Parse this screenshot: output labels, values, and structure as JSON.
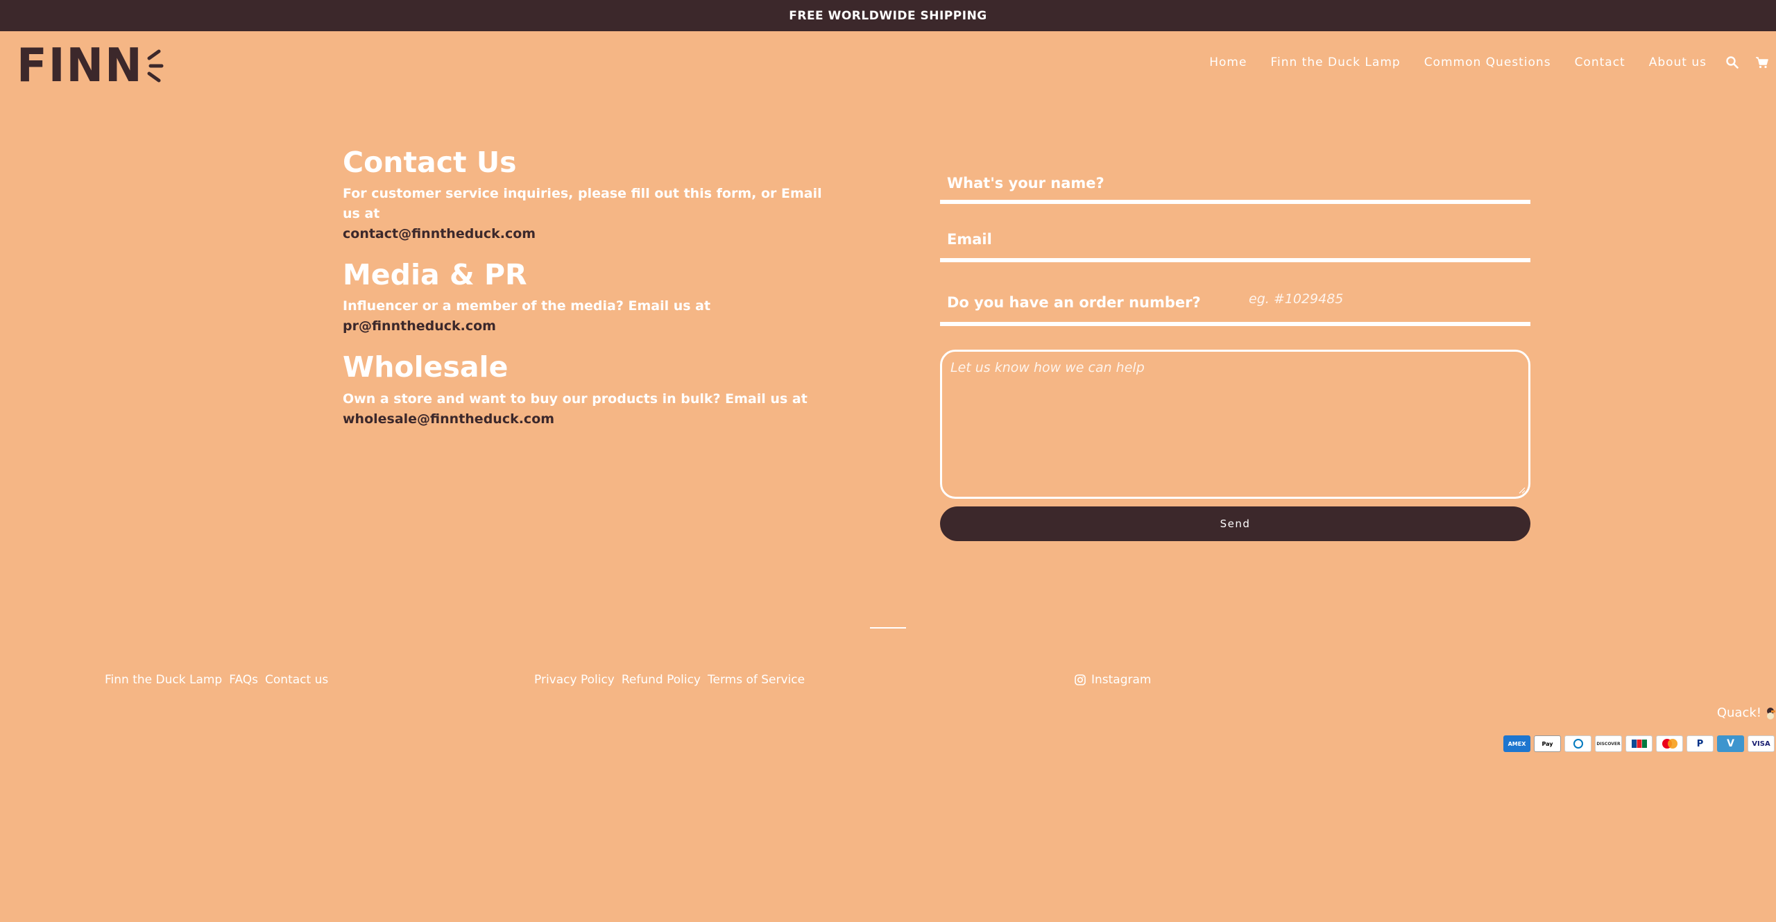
{
  "announcement": "FREE WORLDWIDE SHIPPING",
  "logo": {
    "text": "FINN"
  },
  "nav": {
    "items": [
      "Home",
      "Finn the Duck Lamp",
      "Common Questions",
      "Contact",
      "About us"
    ]
  },
  "contact": {
    "sections": [
      {
        "title": "Contact Us",
        "text": "For customer service inquiries, please fill out this form, or Email us at",
        "email": "contact@finntheduck.com"
      },
      {
        "title": "Media & PR",
        "text": "Influencer or a member of the media? Email us at",
        "email": "pr@finntheduck.com"
      },
      {
        "title": "Wholesale",
        "text": "Own a store and want to buy our products in bulk? Email us at",
        "email": "wholesale@finntheduck.com"
      }
    ]
  },
  "form": {
    "name_label": "What's your name?",
    "email_label": "Email",
    "order_label": "Do you have an order number?",
    "order_placeholder": "eg. #1029485",
    "message_placeholder": "Let us know how we can help",
    "send_label": "Send"
  },
  "footer": {
    "group1": [
      "Finn the Duck Lamp",
      "FAQs",
      "Contact us"
    ],
    "group2": [
      "Privacy Policy",
      "Refund Policy",
      "Terms of Service"
    ],
    "social": "Instagram",
    "quack": "Quack!"
  },
  "payments": [
    "amex",
    "apple-pay",
    "diners",
    "discover",
    "jcb",
    "mastercard",
    "paypal",
    "venmo",
    "visa"
  ],
  "colors": {
    "background": "#F5B685",
    "dark": "#3C282B",
    "white": "#FFFFFF"
  }
}
